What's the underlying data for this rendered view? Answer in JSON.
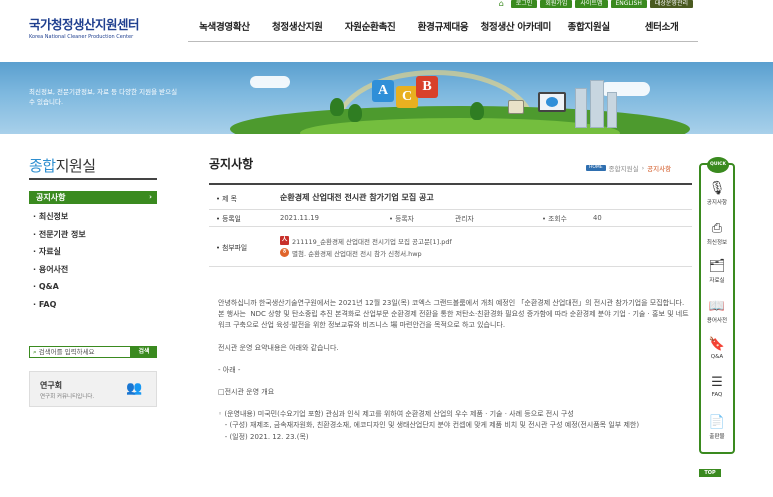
{
  "utility": {
    "items": [
      "로그인",
      "회원가입",
      "사이트맵",
      "ENGLISH",
      "대상운영관리"
    ]
  },
  "logo": {
    "ko": "국가청정생산지원센터",
    "en": "Korea National Cleaner Production Center"
  },
  "gnb": [
    "녹색경영확산",
    "청정생산지원",
    "자원순환촉진",
    "환경규제대응",
    "청정생산 아카데미",
    "종합지원실",
    "센터소개"
  ],
  "banner": {
    "text": "최신정보, 전문기관정보, 자료 등 다양한 지원을 받으실 수 있습니다."
  },
  "sidebar": {
    "title_accent": "종합",
    "title_rest": "지원실",
    "items": [
      "공지사항",
      "최신정보",
      "전문기관 정보",
      "자료실",
      "용어사전",
      "Q&A",
      "FAQ"
    ],
    "search_placeholder": "검색어를 입력하세요",
    "search_button": "검색",
    "lab": {
      "title": "연구회",
      "subtitle": "연구회 커뮤니티입니다."
    }
  },
  "content": {
    "title": "공지사항",
    "breadcrumb": [
      "HOME",
      "종합지원실",
      "공지사항"
    ],
    "post": {
      "subject_label": "제 목",
      "subject": "순환경제 산업대전 전시관 참가기업 모집 공고",
      "date_label": "등록일",
      "date": "2021.11.19",
      "author_label": "등록자",
      "author": "관리자",
      "views_label": "조회수",
      "views": "40",
      "attach_label": "첨부파일",
      "files": [
        "211119_순환경제 산업대전 전시기업 모집 공고문[1].pdf",
        "별첨. 순환경제 산업대전 전시 참가 신청서.hwp"
      ]
    },
    "body": [
      "안녕하십니까 한국생산기술연구원에서는 2021년 12월 23일(목) 코엑스 그랜드볼룸에서 개최 예정인 「순환경제 산업대전」의 전시관 참가기업을 모집합니다.",
      "본 행사는  NDC 상향 및 탄소중립 추진 본격화로 산업부문 순환경제 전환을 통한 저탄소·친환경화 필요성 증가함에 따라 순환경제 분야 기업 · 기술 · 홍보 및 네트워크 구축으로 산업 육성·발전을 위한 정보교류와 비즈니스 場 마련안건을 목적으로 하고 있습니다.",
      "",
      "전시관 운영 요약내용은 아래와 같습니다.",
      "",
      "- 아래 -",
      "",
      "□전시관 운영 개요",
      "",
      "◦ (운영내용) 미국민(수요기업 포함) 관심과 인식 제고를 위하여 순환경제 산업의 우수 제품 · 기술 · 사례 등으로 전시 구성",
      "   - (구성) 재제조, 금속재자원화, 친환경소재, 에코디자인 및 생태산업단지 분야 컨셉에 맞게 제품 비치 및 전시관 구성 예정(전시품목 일부 제한)",
      "   - (일정) 2021. 12. 23.(목)"
    ]
  },
  "quick": {
    "title": "QUICK",
    "items": [
      "공지사항",
      "최신정보",
      "자료실",
      "용어사전",
      "Q&A",
      "FAQ",
      "출판물"
    ],
    "top": "TOP"
  }
}
